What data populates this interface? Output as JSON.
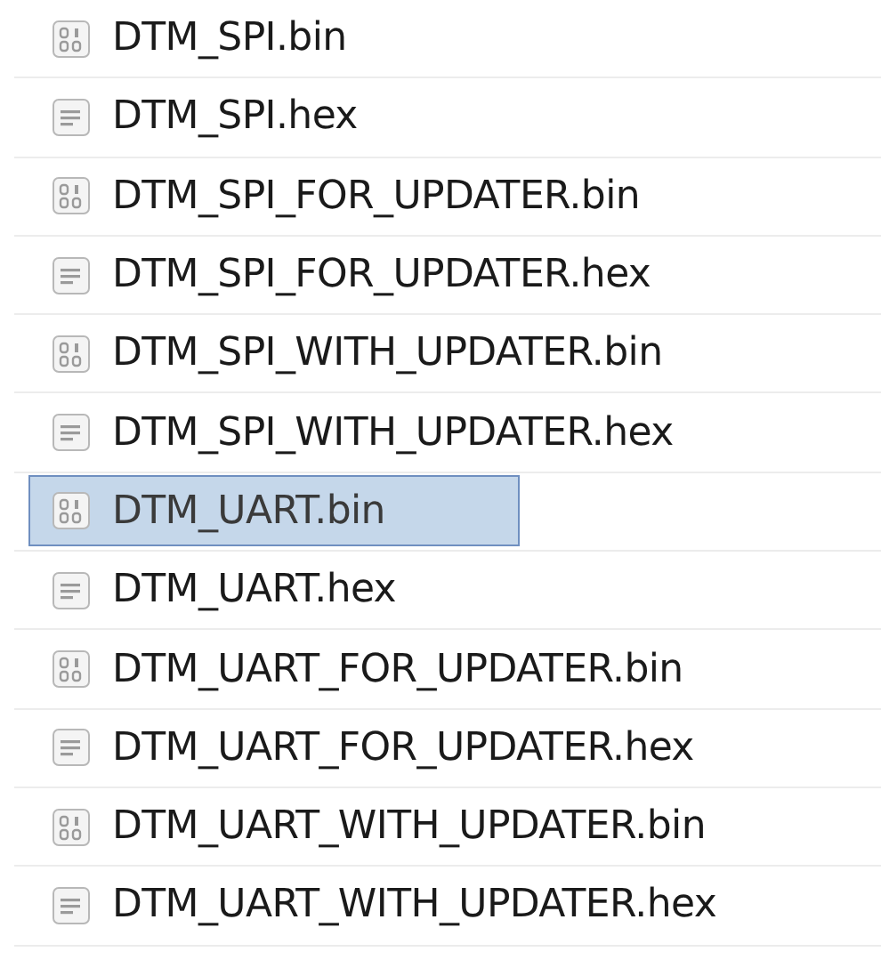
{
  "files": [
    {
      "name": "DTM_SPI.bin",
      "kind": "binary",
      "selected": false
    },
    {
      "name": "DTM_SPI.hex",
      "kind": "text",
      "selected": false
    },
    {
      "name": "DTM_SPI_FOR_UPDATER.bin",
      "kind": "binary",
      "selected": false
    },
    {
      "name": "DTM_SPI_FOR_UPDATER.hex",
      "kind": "text",
      "selected": false
    },
    {
      "name": "DTM_SPI_WITH_UPDATER.bin",
      "kind": "binary",
      "selected": false
    },
    {
      "name": "DTM_SPI_WITH_UPDATER.hex",
      "kind": "text",
      "selected": false
    },
    {
      "name": "DTM_UART.bin",
      "kind": "binary",
      "selected": true
    },
    {
      "name": "DTM_UART.hex",
      "kind": "text",
      "selected": false
    },
    {
      "name": "DTM_UART_FOR_UPDATER.bin",
      "kind": "binary",
      "selected": false
    },
    {
      "name": "DTM_UART_FOR_UPDATER.hex",
      "kind": "text",
      "selected": false
    },
    {
      "name": "DTM_UART_WITH_UPDATER.bin",
      "kind": "binary",
      "selected": false
    },
    {
      "name": "DTM_UART_WITH_UPDATER.hex",
      "kind": "text",
      "selected": false
    }
  ]
}
